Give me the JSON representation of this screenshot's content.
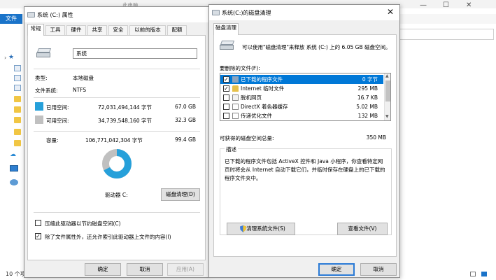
{
  "explorer": {
    "tab_ghost": "此电脑",
    "file_tab": "文件",
    "min_glyph": "—",
    "max_glyph": "☐",
    "close_glyph": "✕",
    "status_text": "10 个项目"
  },
  "props": {
    "title": "系统 (C:) 属性",
    "tabs": [
      "常规",
      "工具",
      "硬件",
      "共享",
      "安全",
      "以前的版本",
      "配额"
    ],
    "drive_name": "系统",
    "type_label": "类型:",
    "type_value": "本地磁盘",
    "fs_label": "文件系统:",
    "fs_value": "NTFS",
    "used_label": "已用空间:",
    "used_bytes": "72,031,494,144 字节",
    "used_gb": "67.0 GB",
    "free_label": "可用空间:",
    "free_bytes": "34,739,548,160 字节",
    "free_gb": "32.3 GB",
    "cap_label": "容量:",
    "cap_bytes": "106,771,042,304 字节",
    "cap_gb": "99.4 GB",
    "drive_label": "驱动器 C:",
    "cleanup_btn": "磁盘清理(D)",
    "compress_label": "压缩此驱动器以节约磁盘空间(C)",
    "index_label": "除了文件属性外，还允许索引此驱动器上文件的内容(I)",
    "index_checked": true,
    "compress_checked": false,
    "ok": "确定",
    "cancel": "取消",
    "apply": "应用(A)",
    "used_fraction": 0.675,
    "colors": {
      "used": "#26a0da",
      "free": "#c0c0c0"
    }
  },
  "cleanup": {
    "title": "系统(C:)的磁盘清理",
    "tab": "磁盘清理",
    "intro": "可以使用\"磁盘清理\"来释放 系统 (C:) 上的 6.05 GB 磁盘空间。",
    "files_label": "要删除的文件(F):",
    "files": [
      {
        "name": "已下载的程序文件",
        "size": "0 字节",
        "checked": true,
        "selected": true,
        "icon": "folder-icon"
      },
      {
        "name": "Internet 临时文件",
        "size": "295 MB",
        "checked": true,
        "selected": false,
        "icon": "lock-icon"
      },
      {
        "name": "脱机网页",
        "size": "16.7 KB",
        "checked": false,
        "selected": false,
        "icon": "page-icon"
      },
      {
        "name": "DirectX 着色器缓存",
        "size": "5.02 MB",
        "checked": false,
        "selected": false,
        "icon": "file-icon"
      },
      {
        "name": "传递优化文件",
        "size": "132 MB",
        "checked": false,
        "selected": false,
        "icon": "file-icon"
      }
    ],
    "total_label": "可获得的磁盘空间总量:",
    "total_value": "350 MB",
    "desc_legend": "描述",
    "desc_text": "已下载的程序文件包括 ActiveX 控件和 Java 小程序，你查看特定网页时将会从 Internet 自动下载它们，并临时保存在硬盘上的已下载的程序文件夹中。",
    "clean_system_btn": "清理系统文件(S)",
    "view_files_btn": "查看文件(V)",
    "ok": "确定",
    "cancel": "取消"
  }
}
